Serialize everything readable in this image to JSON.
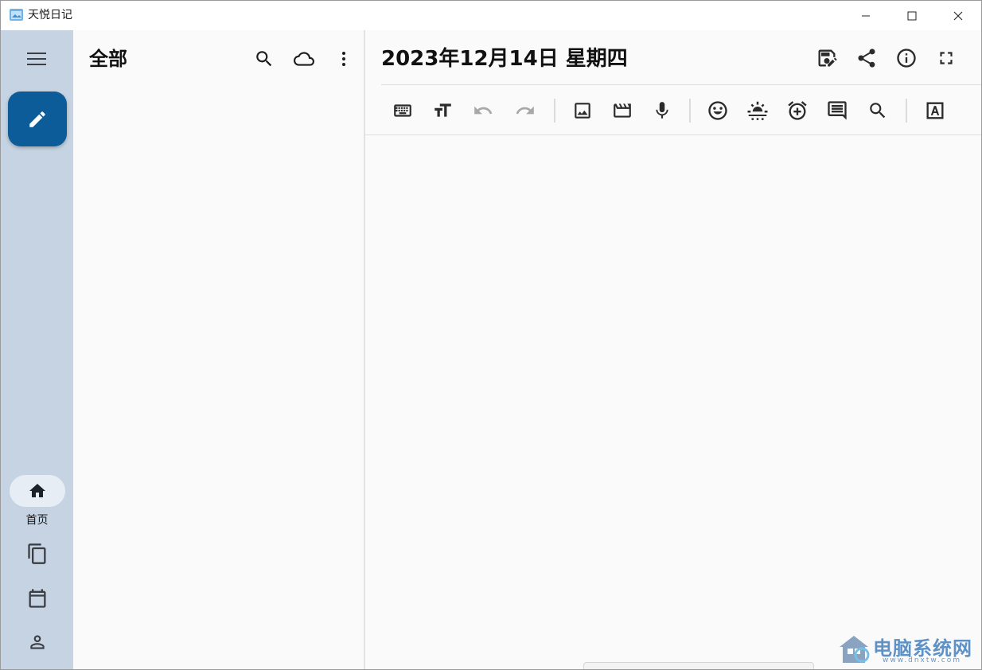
{
  "window": {
    "title": "天悦日记"
  },
  "rail": {
    "fab_icon": "pencil-icon",
    "nav": [
      {
        "id": "home",
        "label": "首页",
        "icon": "home-icon",
        "selected": true
      },
      {
        "id": "documents",
        "icon": "copy-icon"
      },
      {
        "id": "calendar",
        "icon": "calendar-icon"
      },
      {
        "id": "profile",
        "icon": "person-icon"
      }
    ]
  },
  "list_pane": {
    "title": "全部",
    "actions": [
      "search-icon",
      "cloud-icon",
      "more-vertical-icon"
    ]
  },
  "editor": {
    "date_title": "2023年12月14日 星期四",
    "header_actions": [
      "save-edit-icon",
      "share-icon",
      "info-icon",
      "fullscreen-icon"
    ],
    "toolbar": [
      "keyboard-icon",
      "text-size-icon",
      "undo-icon",
      "redo-icon",
      "image-icon",
      "video-icon",
      "mic-icon",
      "emoji-icon",
      "weather-icon",
      "alarm-add-icon",
      "comment-icon",
      "search-icon",
      "font-box-icon"
    ]
  },
  "watermark": {
    "text": "电脑系统网",
    "url": "www.dnxtw.com"
  },
  "colors": {
    "rail_bg": "#c5d3e2",
    "fab_bg": "#0b5c98",
    "pane_bg": "#fafafa",
    "icon": "#2b2b2b",
    "icon_disabled": "#a8a8a8"
  }
}
